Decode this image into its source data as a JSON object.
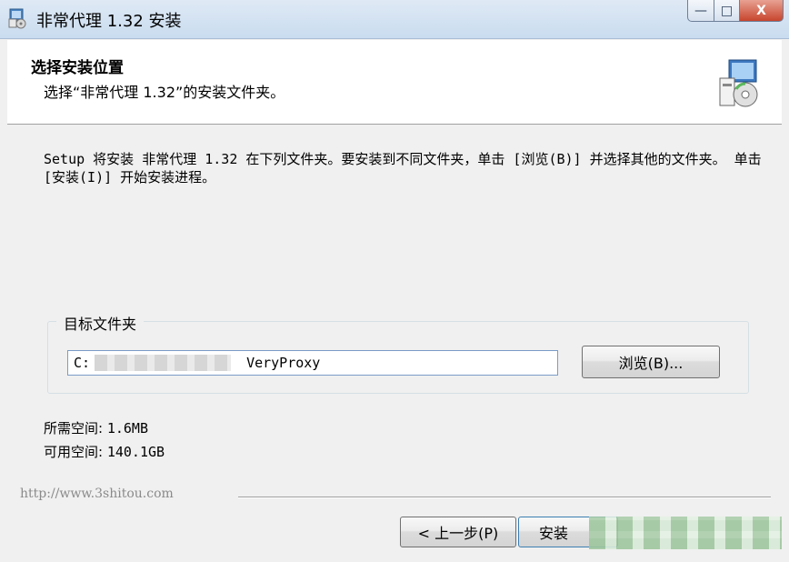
{
  "window": {
    "title": "非常代理 1.32 安装",
    "controls": {
      "minimize": "—",
      "maximize": "□",
      "close": "X"
    }
  },
  "header": {
    "title": "选择安装位置",
    "subtitle": "选择“非常代理 1.32”的安装文件夹。"
  },
  "body": {
    "description": "Setup 将安装 非常代理 1.32 在下列文件夹。要安装到不同文件夹，单击 [浏览(B)] 并选择其他的文件夹。 单击 [安装(I)] 开始安装进程。",
    "group_label": "目标文件夹",
    "path_prefix": "C:",
    "path_suffix": "VeryProxy",
    "browse_label": "浏览(B)...",
    "space_required_label": "所需空间:",
    "space_required_value": "1.6MB",
    "space_available_label": "可用空间:",
    "space_available_value": "140.1GB"
  },
  "footer": {
    "url": "http://www.3shitou.com",
    "back_label": "< 上一步(P)",
    "install_label": "安装"
  },
  "icons": {
    "app": "installer-icon",
    "header": "installer-cd-icon"
  }
}
